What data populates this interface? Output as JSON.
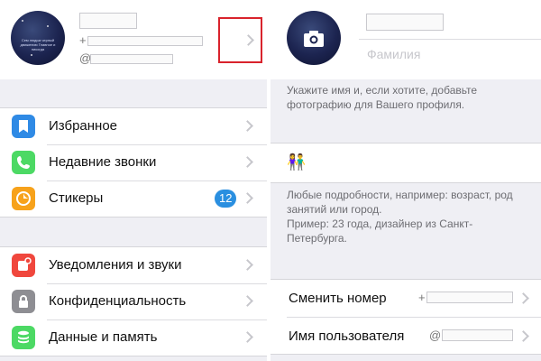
{
  "left": {
    "profile": {
      "phone_prefix": "+",
      "username_prefix": "@",
      "avatar_text": "Сем людьм черный движению Главное и никогда"
    },
    "menu_group_1": [
      {
        "label": "Избранное",
        "icon": "bookmark-icon",
        "color": "#2f8ae5"
      },
      {
        "label": "Недавние звонки",
        "icon": "phone-icon",
        "color": "#4cd964"
      },
      {
        "label": "Стикеры",
        "icon": "sticker-icon",
        "color": "#f7a21b",
        "badge": "12"
      }
    ],
    "menu_group_2": [
      {
        "label": "Уведомления и звуки",
        "icon": "notification-icon",
        "color": "#f0473d"
      },
      {
        "label": "Конфиденциальность",
        "icon": "lock-icon",
        "color": "#8e8e93"
      },
      {
        "label": "Данные и память",
        "icon": "data-icon",
        "color": "#4cd964"
      }
    ]
  },
  "right": {
    "lastname_placeholder": "Фамилия",
    "name_hint": "Укажите имя и, если хотите, добавьте фотографию для Вашего профиля.",
    "bio_emoji": "👫",
    "bio_hint_1": "Любые подробности, например: возраст, род занятий или город.",
    "bio_hint_2": "Пример: 23 года, дизайнер из Санкт-Петербурга.",
    "change_number_label": "Сменить номер",
    "change_number_prefix": "+",
    "username_label": "Имя пользователя",
    "username_prefix": "@"
  },
  "colors": {
    "accent": "#2a8fe0",
    "highlight_box": "#d9232c",
    "background": "#efeff4"
  }
}
